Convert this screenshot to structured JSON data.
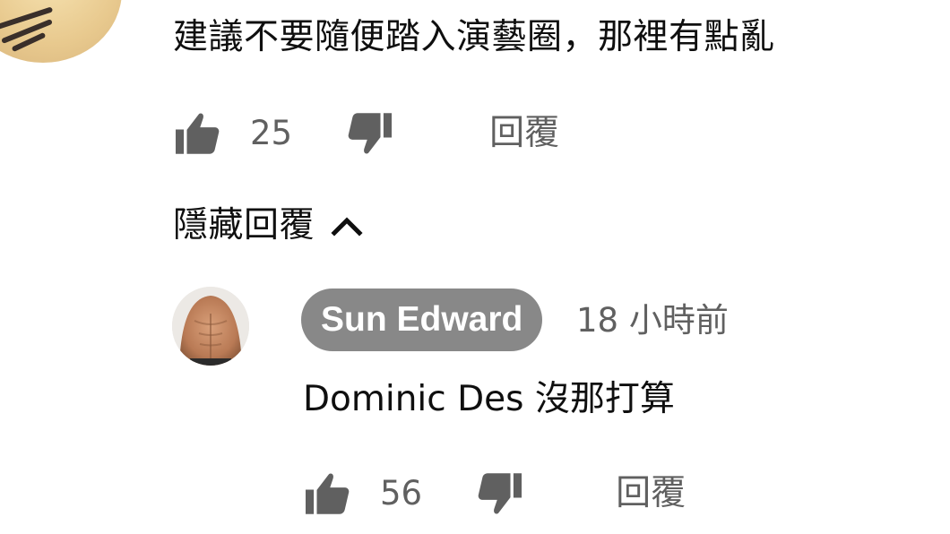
{
  "parent_comment": {
    "text": "建議不要隨便踏入演藝圈，那裡有點亂",
    "like_count": "25",
    "reply_label": "回覆"
  },
  "hide_replies": {
    "label": "隱藏回覆",
    "icon": "chevron-up-icon"
  },
  "reply": {
    "author": "Sun Edward",
    "timestamp": "18 小時前",
    "text": "Dominic Des 沒那打算",
    "like_count": "56",
    "reply_label": "回覆"
  },
  "colors": {
    "text_primary": "#0f0f0f",
    "text_secondary": "#606060",
    "author_chip": "#888888",
    "icon": "#606060"
  }
}
